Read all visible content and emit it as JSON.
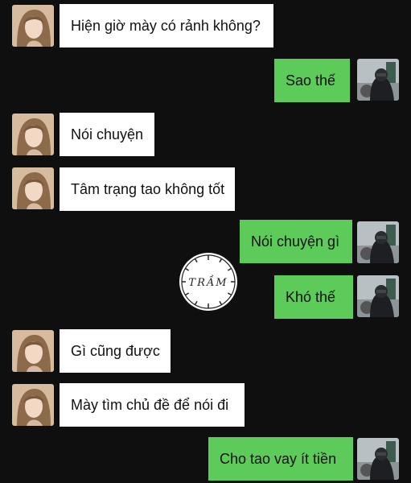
{
  "colors": {
    "background": "#0f0f0f",
    "incoming_bubble": "#ffffff",
    "outgoing_bubble": "#5ccb59",
    "text": "#111111"
  },
  "watermark": {
    "text": "TRẦM",
    "icon": "clock-seal-icon"
  },
  "messages": [
    {
      "side": "left",
      "text": "Hiện giờ mày có rảnh không?"
    },
    {
      "side": "right",
      "text": "Sao thế"
    },
    {
      "side": "left",
      "text": "Nói chuyện"
    },
    {
      "side": "left",
      "text": "Tâm trạng tao không tốt"
    },
    {
      "side": "right",
      "text": "Nói chuyện gì"
    },
    {
      "side": "right",
      "text": "Khó thế"
    },
    {
      "side": "left",
      "text": "Gì cũng được"
    },
    {
      "side": "left",
      "text": "Mày tìm chủ đề để nói đi"
    },
    {
      "side": "right",
      "text": "Cho tao vay ít tiền"
    }
  ]
}
